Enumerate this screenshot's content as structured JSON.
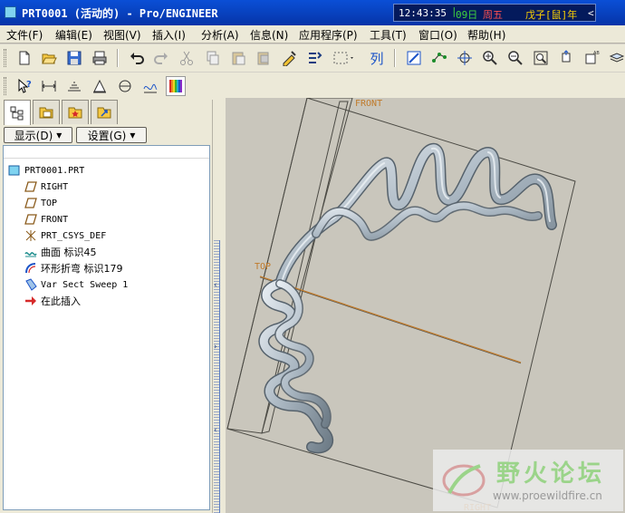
{
  "window": {
    "title": "PRT0001 (活动的) - Pro/ENGINEER",
    "clock_time": "12:43:35",
    "clock_date": "09日",
    "clock_weekday": "周五",
    "clock_lunar": "戊子[鼠]年",
    "clock_arrow": "<"
  },
  "menu": [
    {
      "label": "文件(F)"
    },
    {
      "label": "编辑(E)"
    },
    {
      "label": "视图(V)"
    },
    {
      "label": "插入(I)"
    },
    {
      "label": "分析(A)"
    },
    {
      "label": "信息(N)"
    },
    {
      "label": "应用程序(P)"
    },
    {
      "label": "工具(T)"
    },
    {
      "label": "窗口(O)"
    },
    {
      "label": "帮助(H)"
    }
  ],
  "toolbar": {
    "list_label": "列"
  },
  "model_tree": {
    "show_button": "显示(D)",
    "settings_button": "设置(G)",
    "items": [
      {
        "label": "PRT0001.PRT",
        "icon": "part-icon"
      },
      {
        "label": "RIGHT",
        "icon": "datum-plane-icon"
      },
      {
        "label": "TOP",
        "icon": "datum-plane-icon"
      },
      {
        "label": "FRONT",
        "icon": "datum-plane-icon"
      },
      {
        "label": "PRT_CSYS_DEF",
        "icon": "csys-icon"
      },
      {
        "label": "曲面 标识45",
        "icon": "surface-icon"
      },
      {
        "label": "环形折弯 标识179",
        "icon": "toroidal-bend-icon"
      },
      {
        "label": "Var Sect Sweep 1",
        "icon": "sweep-icon"
      },
      {
        "label": "在此插入",
        "icon": "insert-here-arrow-icon"
      }
    ]
  },
  "graphics": {
    "datum_labels": {
      "front": "FRONT",
      "top": "TOP",
      "right": "RIGHT"
    }
  },
  "watermark": {
    "name": "野火论坛",
    "url": "www.proewildfire.cn"
  },
  "colors": {
    "titlebar": "#0a4fd6",
    "background": "#ece9d8",
    "graphics_bg": "#c9c6bc",
    "datum": "#c07a2a",
    "spring": "#a9b6c1"
  }
}
